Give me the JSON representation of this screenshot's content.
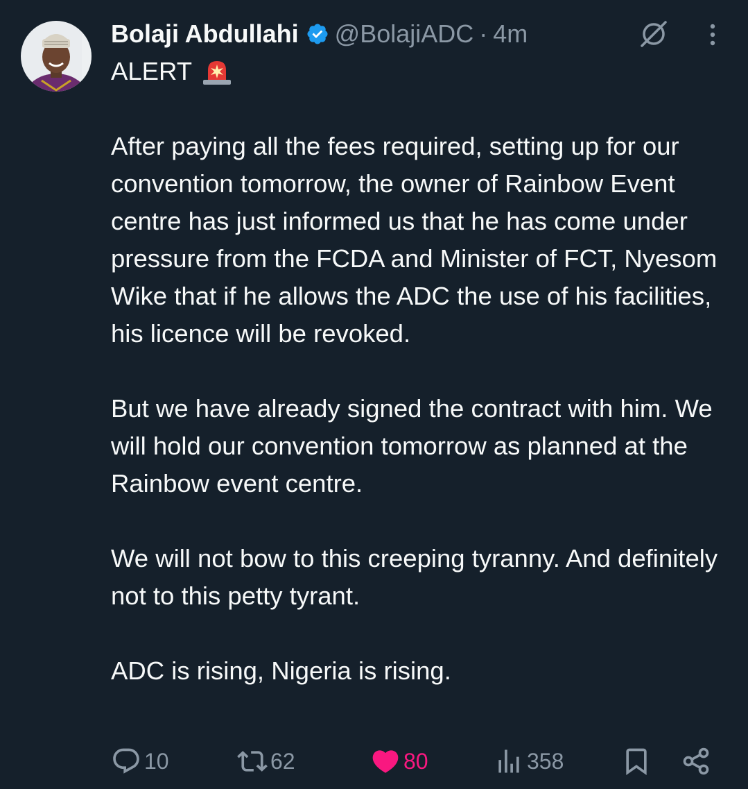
{
  "author": {
    "display_name": "Bolaji Abdullahi",
    "handle": "@BolajiADC",
    "separator": "·",
    "time": "4m",
    "verified_color": "#1d9bf0"
  },
  "tweet": {
    "alert": "ALERT",
    "alert_emoji": "rotating-light-icon",
    "paragraphs": [
      "After paying all the fees required, setting up for our convention tomorrow,  the owner of Rainbow Event centre has just informed us that he has come under pressure from the FCDA and Minister of FCT, Nyesom Wike that if he allows the ADC the use of his facilities, his licence will be revoked.",
      "But we have already signed the contract with him. We will hold our convention tomorrow as planned at the Rainbow event centre.",
      "We will not bow to this creeping tyranny. And definitely not to this petty tyrant.",
      "ADC is rising,  Nigeria is rising."
    ]
  },
  "actions": {
    "replies": "10",
    "reposts": "62",
    "likes": "80",
    "views": "358",
    "like_color": "#f91880"
  },
  "theme": {
    "background": "#15202b",
    "text": "#f7f9f9",
    "secondary": "#8b98a5"
  }
}
